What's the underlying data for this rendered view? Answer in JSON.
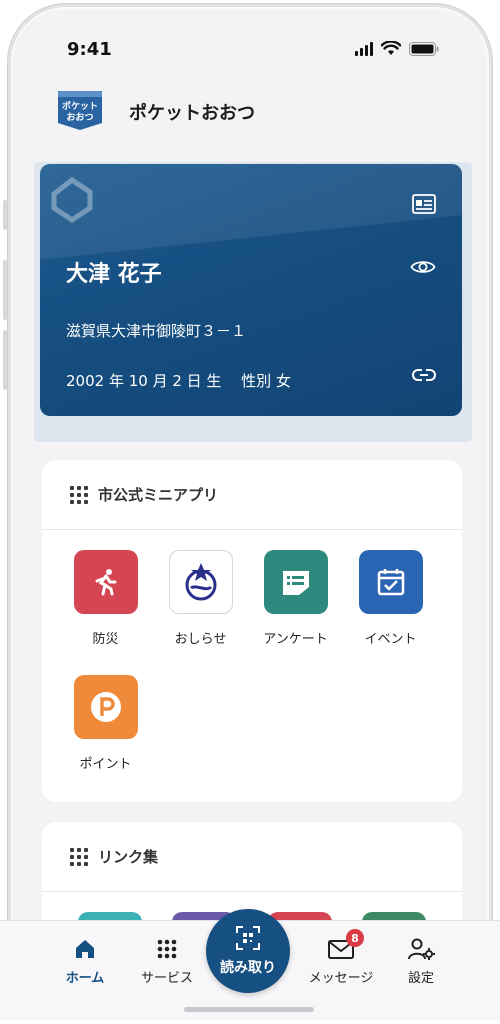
{
  "status_bar": {
    "time": "9:41"
  },
  "header": {
    "logo_line1": "ポケット",
    "logo_line2": "おおつ",
    "title": "ポケットおおつ"
  },
  "card": {
    "name": "大津 花子",
    "address": "滋賀県大津市御陵町３－１",
    "birth_gender": "2002 年 10 月 2 日 生　 性別 女"
  },
  "apps_section": {
    "title": "市公式ミニアプリ",
    "items": [
      {
        "label": "防災",
        "icon": "running-person-icon",
        "color": "#d64552"
      },
      {
        "label": "おしらせ",
        "icon": "city-emblem-icon",
        "color": "#ffffff"
      },
      {
        "label": "アンケート",
        "icon": "survey-icon",
        "color": "#2e8a7e"
      },
      {
        "label": "イベント",
        "icon": "calendar-check-icon",
        "color": "#2a65b4"
      },
      {
        "label": "ポイント",
        "icon": "point-p-icon",
        "color": "#ef8a3a"
      }
    ]
  },
  "links_section": {
    "title": "リンク集"
  },
  "bottom_nav": {
    "home": "ホーム",
    "services": "サービス",
    "scan": "読み取り",
    "messages": "メッセージ",
    "message_badge": "8",
    "settings": "設定"
  },
  "colors": {
    "primary": "#164f82",
    "badge": "#d93c45"
  }
}
